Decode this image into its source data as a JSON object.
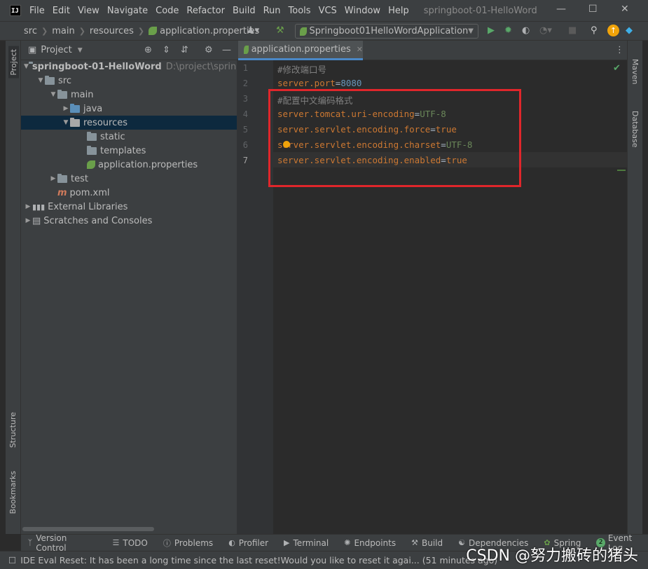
{
  "menubar": {
    "logo": "IJ",
    "items": [
      "File",
      "Edit",
      "View",
      "Navigate",
      "Code",
      "Refactor",
      "Build",
      "Run",
      "Tools",
      "VCS",
      "Window",
      "Help"
    ],
    "title": "springboot-01-HelloWord"
  },
  "navbar": {
    "crumbs": [
      "src",
      "main",
      "resources",
      "application.properties"
    ],
    "run_config": "Springboot01HelloWordApplication"
  },
  "sidebar_left": {
    "project": "Project",
    "structure": "Structure",
    "bookmarks": "Bookmarks"
  },
  "sidebar_right": {
    "maven": "Maven",
    "database": "Database"
  },
  "project_panel": {
    "title": "Project",
    "tree": [
      {
        "label": "springboot-01-HelloWord",
        "extra": "D:\\project\\spring"
      },
      {
        "label": "src"
      },
      {
        "label": "main"
      },
      {
        "label": "java"
      },
      {
        "label": "resources"
      },
      {
        "label": "static"
      },
      {
        "label": "templates"
      },
      {
        "label": "application.properties"
      },
      {
        "label": "test"
      },
      {
        "label": "pom.xml"
      },
      {
        "label": "External Libraries"
      },
      {
        "label": "Scratches and Consoles"
      }
    ]
  },
  "editor": {
    "tab_label": "application.properties",
    "lines": [
      {
        "num": "1",
        "comment": "#修改端口号"
      },
      {
        "num": "2",
        "key": "server.port",
        "eq": "=",
        "value": "8080"
      },
      {
        "num": "3",
        "comment": "#配置中文编码格式"
      },
      {
        "num": "4",
        "key": "server.tomcat.uri-encoding",
        "eq": "=",
        "value": "UTF-8"
      },
      {
        "num": "5",
        "key": "server.servlet.encoding.force",
        "eq": "=",
        "value": "true"
      },
      {
        "num": "6",
        "key": "server.servlet.encoding.charset",
        "eq": "=",
        "value": "UTF-8"
      },
      {
        "num": "7",
        "key": "server.servlet.encoding.enabled",
        "eq": "=",
        "value": "true"
      }
    ]
  },
  "bottom_tools": [
    "Version Control",
    "TODO",
    "Problems",
    "Profiler",
    "Terminal",
    "Endpoints",
    "Build",
    "Dependencies",
    "Spring",
    "Event Log"
  ],
  "event_log_count": "2",
  "status_text": "IDE Eval Reset: It has been a long time since the last reset!Would you like to reset it agai... (51 minutes ago)",
  "watermark": "CSDN @努力搬砖的猪头",
  "colors": {
    "accent": "#4a88c7",
    "highlight_box": "#e0262b",
    "keyword": "#cc7832",
    "string": "#6a8759",
    "number": "#6897bb"
  }
}
